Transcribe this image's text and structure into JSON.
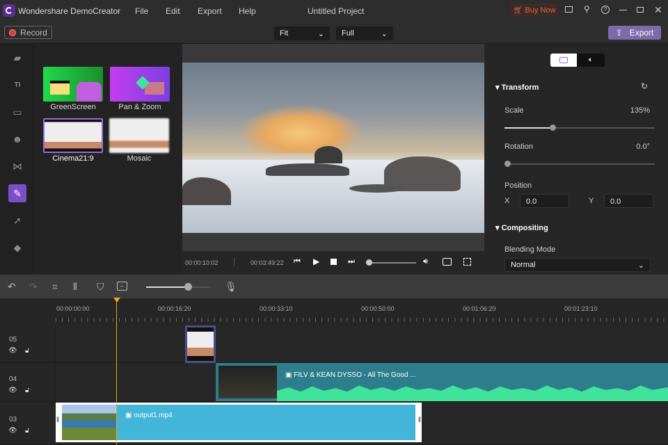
{
  "app": {
    "title": "Wondershare DemoCreator",
    "project": "Untitled Project",
    "menu": [
      "File",
      "Edit",
      "Export",
      "Help"
    ],
    "buy_now": "Buy Now"
  },
  "toolbar": {
    "record": "Record",
    "fit": "Fit",
    "quality": "Full",
    "export": "Export"
  },
  "effects": [
    {
      "label": "GreenScreen"
    },
    {
      "label": "Pan & Zoom"
    },
    {
      "label": "Cinema21:9"
    },
    {
      "label": "Mosaic"
    }
  ],
  "player": {
    "current": "00:00:10:02",
    "total": "00:03:49:22",
    "volume": 0.05
  },
  "properties": {
    "transform": "Transform",
    "scale_label": "Scale",
    "scale_value": "135%",
    "scale_fraction": 0.32,
    "rotation_label": "Rotation",
    "rotation_value": "0.0°",
    "position_label": "Position",
    "x_label": "X",
    "x_value": "0.0",
    "y_label": "Y",
    "y_value": "0.0",
    "compositing": "Compositing",
    "blending_label": "Blending Mode",
    "blending_value": "Normal"
  },
  "timeline": {
    "zoom": 0.65,
    "ticks": [
      "00:00:00:00",
      "00:00:16:20",
      "00:00:33:10",
      "00:00:50:00",
      "00:01:06:20",
      "00:01:23:10"
    ],
    "tracks": [
      {
        "num": "05"
      },
      {
        "num": "04",
        "clip": "FILV & KEAN DYSSO - All The Good ..."
      },
      {
        "num": "03",
        "clip": "output1.mp4"
      }
    ]
  },
  "colors": {
    "accent": "#7b4fc7",
    "export": "#7d6aa8",
    "clip_blue": "#43b5d8",
    "clip_teal": "#2e7d8c",
    "wave": "#3fe39a",
    "playhead": "#f0a820"
  }
}
